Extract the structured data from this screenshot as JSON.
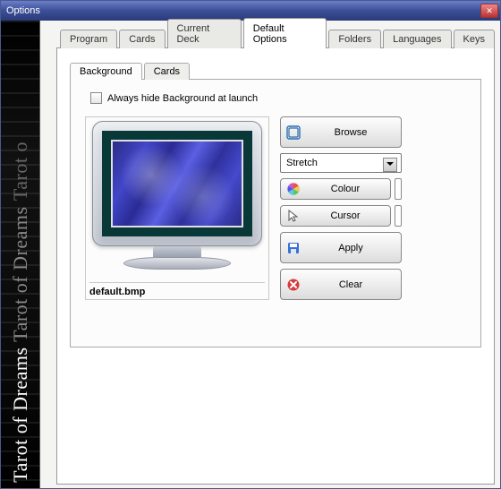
{
  "window": {
    "title": "Options"
  },
  "sidebar": {
    "text_bright": "Tarot of Dreams",
    "text_mid": "Tarot of Dreams",
    "text_dim": "Tarot o"
  },
  "tabs": {
    "items": [
      "Program",
      "Cards",
      "Current Deck",
      "Default Options",
      "Folders",
      "Languages",
      "Keys"
    ],
    "active": 3
  },
  "subtabs": {
    "items": [
      "Background",
      "Cards"
    ],
    "active": 0
  },
  "checkbox": {
    "label": "Always hide Background at launch",
    "checked": false
  },
  "preview": {
    "filename": "default.bmp"
  },
  "controls": {
    "browse": "Browse",
    "mode_selected": "Stretch",
    "colour": "Colour",
    "cursor": "Cursor",
    "apply": "Apply",
    "clear": "Clear"
  }
}
